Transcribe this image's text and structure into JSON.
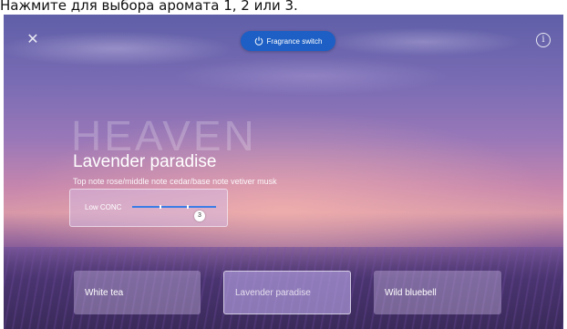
{
  "caption": "Нажмите для выбора аромата 1, 2 или 3.",
  "topbar": {
    "close_icon": "close-icon",
    "switch_label": "Fragrance switch",
    "power_icon": "power-icon",
    "info_icon": "info-icon",
    "info_glyph": "i"
  },
  "hero": {
    "bigword": "HEAVEN",
    "title": "Lavender paradise",
    "subtitle": "Top note rose/middle note cedar/base note vetiver musk"
  },
  "concentration": {
    "label": "Low CONC",
    "level": 3,
    "max_level": 3,
    "accent": "#3a7ce6"
  },
  "fragrances": [
    {
      "label": "White tea",
      "selected": false
    },
    {
      "label": "Lavender paradise",
      "selected": true
    },
    {
      "label": "Wild bluebell",
      "selected": false
    }
  ],
  "colors": {
    "switch_bg": "#1d5fc4"
  }
}
